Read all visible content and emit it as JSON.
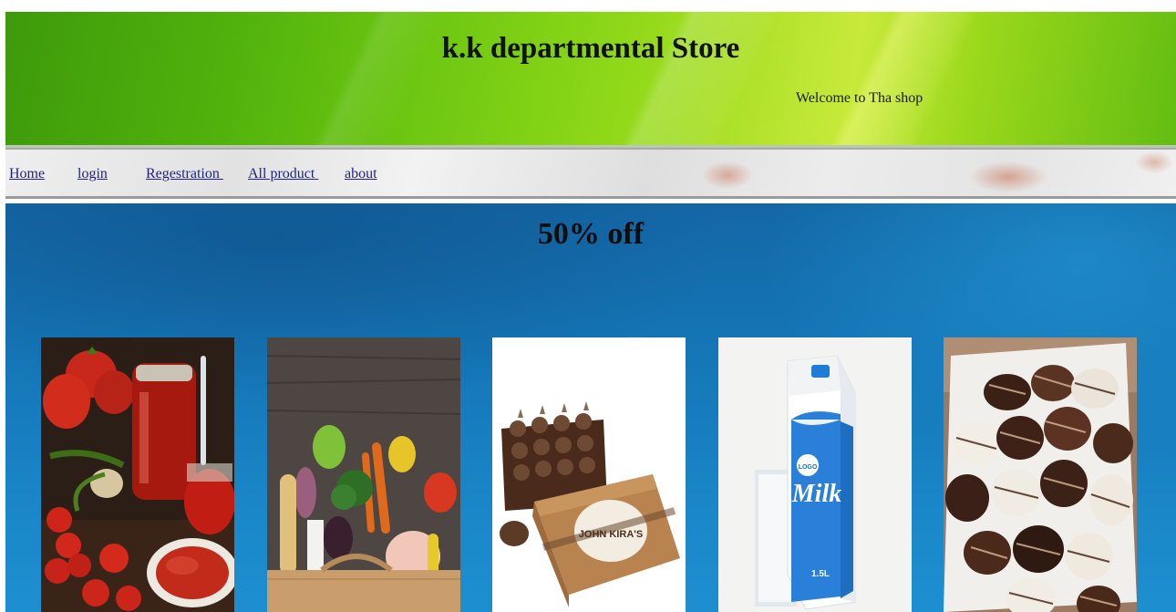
{
  "header": {
    "title": "k.k departmental Store",
    "welcome": "Welcome to Tha shop"
  },
  "nav": {
    "items": [
      {
        "label": "Home"
      },
      {
        "label": "login"
      },
      {
        "label": "Regestration "
      },
      {
        "label": "All product "
      },
      {
        "label": "about"
      }
    ]
  },
  "main": {
    "promo": "50% off",
    "products": [
      {
        "image": "tomato-sauce-jar"
      },
      {
        "image": "grocery-bag-vegetables"
      },
      {
        "image": "chocolate-box",
        "box_text": "JOHN KIRA'S"
      },
      {
        "image": "milk-carton",
        "carton_text": "Milk",
        "logo_text": "LOGO",
        "size_text": "1.5L"
      },
      {
        "image": "chocolate-covered-cookies"
      }
    ]
  },
  "colors": {
    "header_green": "#6cc611",
    "main_blue": "#1577b8",
    "link": "#1f1f8a"
  }
}
